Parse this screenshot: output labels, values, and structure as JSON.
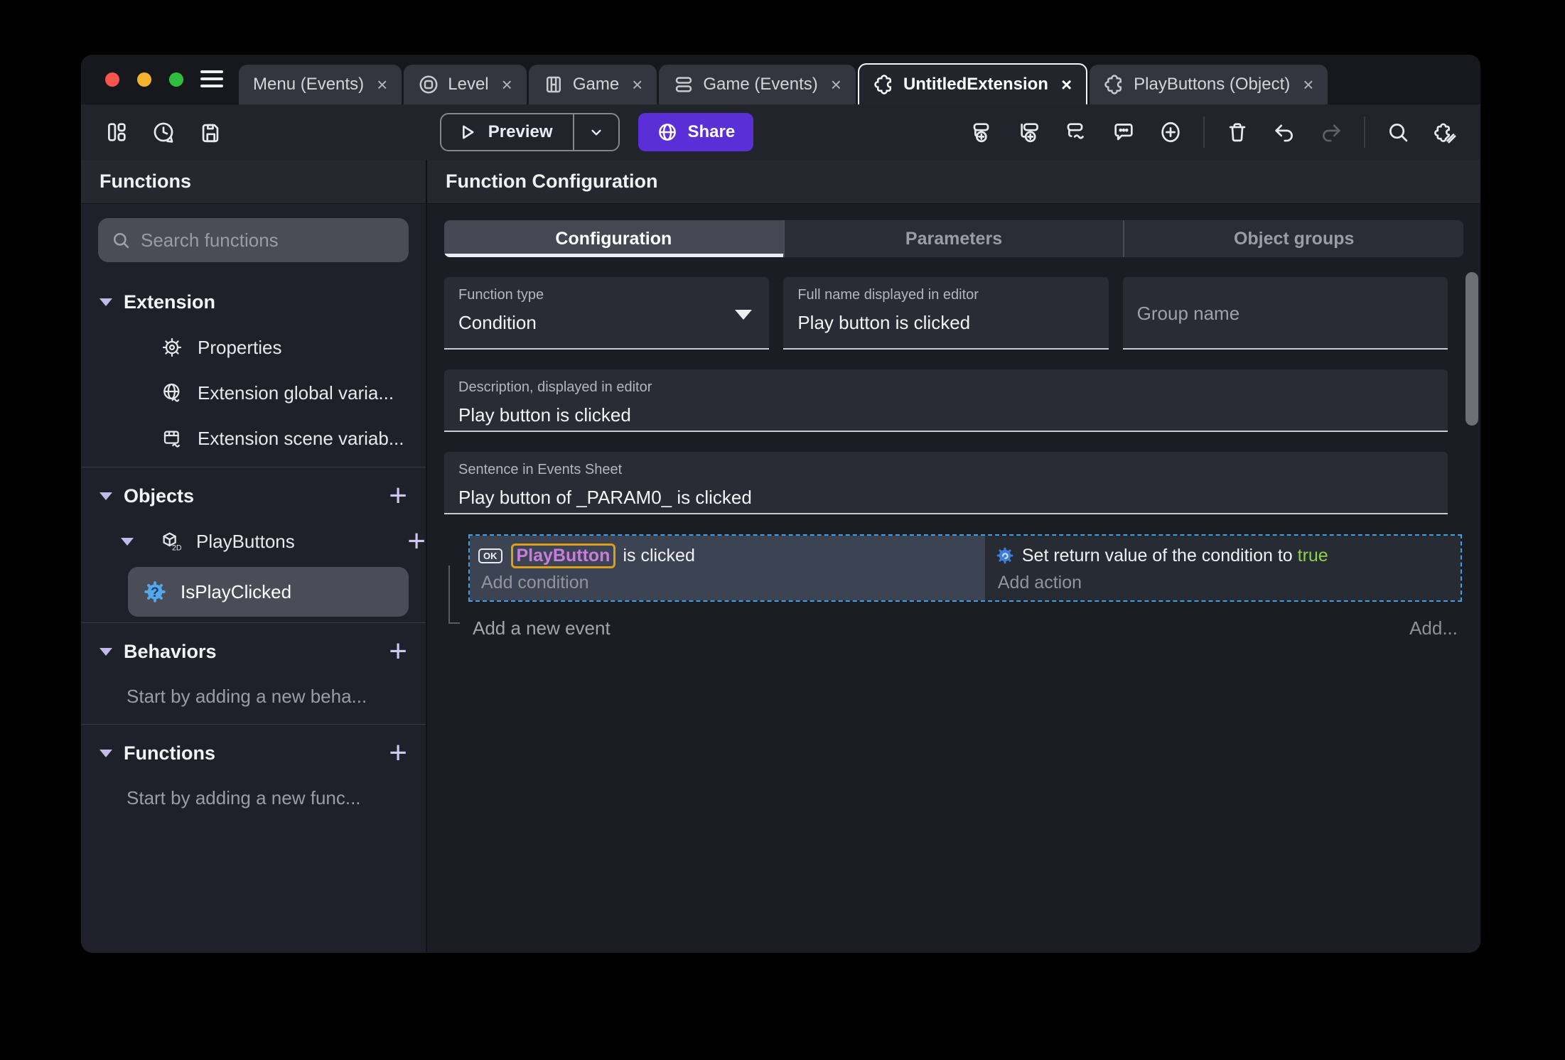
{
  "window": {
    "tabs": [
      {
        "label": "Menu (Events)",
        "close": "×"
      },
      {
        "label": "Level",
        "close": "×"
      },
      {
        "label": "Game",
        "close": "×"
      },
      {
        "label": "Game (Events)",
        "close": "×"
      },
      {
        "label": "UntitledExtension",
        "close": "×"
      },
      {
        "label": "PlayButtons (Object)",
        "close": "×"
      }
    ]
  },
  "toolbar": {
    "preview": "Preview",
    "share": "Share"
  },
  "sidebar": {
    "title": "Functions",
    "search_placeholder": "Search functions",
    "extension_section": "Extension",
    "properties_item": "Properties",
    "global_vars_item": "Extension global varia...",
    "scene_vars_item": "Extension scene variab...",
    "objects_section": "Objects",
    "playbuttons_item": "PlayButtons",
    "selected_function": "IsPlayClicked",
    "behaviors_section": "Behaviors",
    "behaviors_empty": "Start by adding a new beha...",
    "functions_section": "Functions",
    "functions_empty": "Start by adding a new func...",
    "plus": "+"
  },
  "main": {
    "title": "Function Configuration",
    "tabs": [
      {
        "label": "Configuration"
      },
      {
        "label": "Parameters"
      },
      {
        "label": "Object groups"
      }
    ],
    "function_type_label": "Function type",
    "function_type_value": "Condition",
    "full_name_label": "Full name displayed in editor",
    "full_name_value": "Play button is clicked",
    "group_name_placeholder": "Group name",
    "description_label": "Description, displayed in editor",
    "description_value": "Play button is clicked",
    "sentence_label": "Sentence in Events Sheet",
    "sentence_value": "Play button of _PARAM0_ is clicked"
  },
  "events": {
    "condition_object_icon": "OK",
    "condition_object": "PlayButton",
    "condition_text": " is clicked",
    "add_condition": "Add condition",
    "action_text": "Set return value of the condition to ",
    "action_value": "true",
    "add_action": "Add action",
    "add_new_event": "Add a new event",
    "add_more": "Add..."
  },
  "colors": {
    "share_purple": "#5a2fd8",
    "selected_event_border_blue": "#3f9fe0",
    "object_highlight_orange": "#dd9e1b",
    "object_name_purple": "#c77ddb",
    "boolean_true_green": "#8fd14f"
  }
}
